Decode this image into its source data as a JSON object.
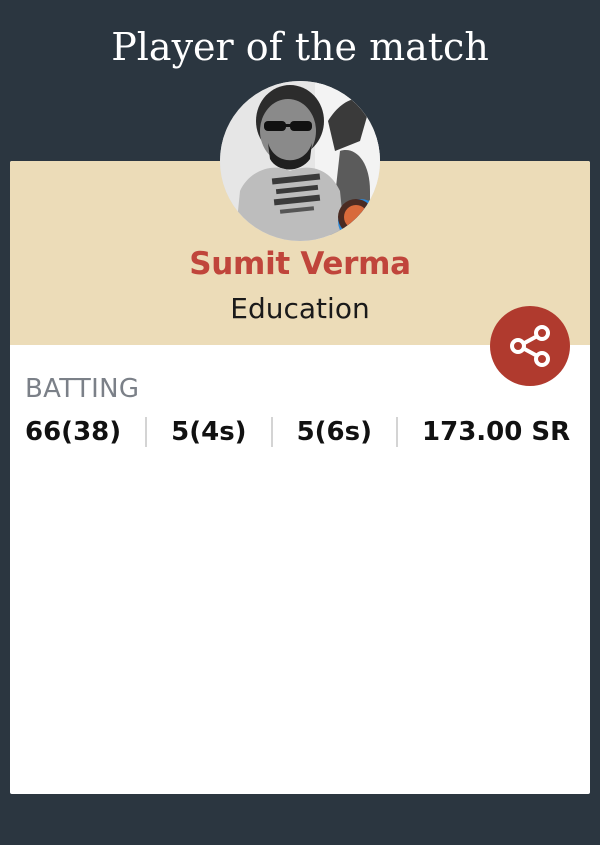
{
  "header": {
    "title": "Player of the match"
  },
  "player": {
    "name": "Sumit Verma",
    "team": "Education",
    "avatar_alt": "player-photo"
  },
  "batting": {
    "label": "BATTING",
    "runs_balls": "66(38)",
    "fours": "5(4s)",
    "sixes": "5(6s)",
    "strike_rate": "173.00 SR"
  },
  "colors": {
    "background": "#2b3640",
    "card_header": "#ecdcb8",
    "name_accent": "#c0453b",
    "share_button": "#b03a2e"
  },
  "icons": {
    "share": "share-icon"
  }
}
